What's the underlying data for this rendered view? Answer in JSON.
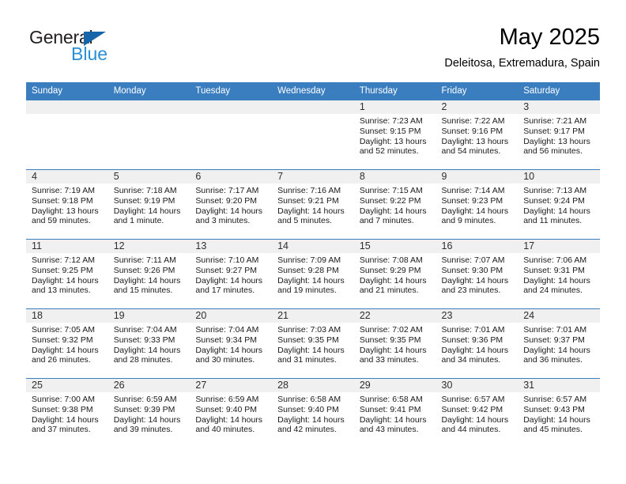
{
  "brand": {
    "name_part1": "General",
    "name_part2": "Blue",
    "triangle_color": "#1565a8",
    "blue_color": "#2a8fd4"
  },
  "header": {
    "month_title": "May 2025",
    "location": "Deleitosa, Extremadura, Spain"
  },
  "theme": {
    "header_bg": "#3a7ec0",
    "daynum_bg": "#f0f0f0",
    "cell_border": "#3a7ec0"
  },
  "weekday_headers": [
    "Sunday",
    "Monday",
    "Tuesday",
    "Wednesday",
    "Thursday",
    "Friday",
    "Saturday"
  ],
  "weeks": [
    [
      {
        "day": "",
        "sunrise": "",
        "sunset": "",
        "daylight1": "",
        "daylight2": "",
        "empty": true
      },
      {
        "day": "",
        "sunrise": "",
        "sunset": "",
        "daylight1": "",
        "daylight2": "",
        "empty": true
      },
      {
        "day": "",
        "sunrise": "",
        "sunset": "",
        "daylight1": "",
        "daylight2": "",
        "empty": true
      },
      {
        "day": "",
        "sunrise": "",
        "sunset": "",
        "daylight1": "",
        "daylight2": "",
        "empty": true
      },
      {
        "day": "1",
        "sunrise": "Sunrise: 7:23 AM",
        "sunset": "Sunset: 9:15 PM",
        "daylight1": "Daylight: 13 hours",
        "daylight2": "and 52 minutes."
      },
      {
        "day": "2",
        "sunrise": "Sunrise: 7:22 AM",
        "sunset": "Sunset: 9:16 PM",
        "daylight1": "Daylight: 13 hours",
        "daylight2": "and 54 minutes."
      },
      {
        "day": "3",
        "sunrise": "Sunrise: 7:21 AM",
        "sunset": "Sunset: 9:17 PM",
        "daylight1": "Daylight: 13 hours",
        "daylight2": "and 56 minutes."
      }
    ],
    [
      {
        "day": "4",
        "sunrise": "Sunrise: 7:19 AM",
        "sunset": "Sunset: 9:18 PM",
        "daylight1": "Daylight: 13 hours",
        "daylight2": "and 59 minutes."
      },
      {
        "day": "5",
        "sunrise": "Sunrise: 7:18 AM",
        "sunset": "Sunset: 9:19 PM",
        "daylight1": "Daylight: 14 hours",
        "daylight2": "and 1 minute."
      },
      {
        "day": "6",
        "sunrise": "Sunrise: 7:17 AM",
        "sunset": "Sunset: 9:20 PM",
        "daylight1": "Daylight: 14 hours",
        "daylight2": "and 3 minutes."
      },
      {
        "day": "7",
        "sunrise": "Sunrise: 7:16 AM",
        "sunset": "Sunset: 9:21 PM",
        "daylight1": "Daylight: 14 hours",
        "daylight2": "and 5 minutes."
      },
      {
        "day": "8",
        "sunrise": "Sunrise: 7:15 AM",
        "sunset": "Sunset: 9:22 PM",
        "daylight1": "Daylight: 14 hours",
        "daylight2": "and 7 minutes."
      },
      {
        "day": "9",
        "sunrise": "Sunrise: 7:14 AM",
        "sunset": "Sunset: 9:23 PM",
        "daylight1": "Daylight: 14 hours",
        "daylight2": "and 9 minutes."
      },
      {
        "day": "10",
        "sunrise": "Sunrise: 7:13 AM",
        "sunset": "Sunset: 9:24 PM",
        "daylight1": "Daylight: 14 hours",
        "daylight2": "and 11 minutes."
      }
    ],
    [
      {
        "day": "11",
        "sunrise": "Sunrise: 7:12 AM",
        "sunset": "Sunset: 9:25 PM",
        "daylight1": "Daylight: 14 hours",
        "daylight2": "and 13 minutes."
      },
      {
        "day": "12",
        "sunrise": "Sunrise: 7:11 AM",
        "sunset": "Sunset: 9:26 PM",
        "daylight1": "Daylight: 14 hours",
        "daylight2": "and 15 minutes."
      },
      {
        "day": "13",
        "sunrise": "Sunrise: 7:10 AM",
        "sunset": "Sunset: 9:27 PM",
        "daylight1": "Daylight: 14 hours",
        "daylight2": "and 17 minutes."
      },
      {
        "day": "14",
        "sunrise": "Sunrise: 7:09 AM",
        "sunset": "Sunset: 9:28 PM",
        "daylight1": "Daylight: 14 hours",
        "daylight2": "and 19 minutes."
      },
      {
        "day": "15",
        "sunrise": "Sunrise: 7:08 AM",
        "sunset": "Sunset: 9:29 PM",
        "daylight1": "Daylight: 14 hours",
        "daylight2": "and 21 minutes."
      },
      {
        "day": "16",
        "sunrise": "Sunrise: 7:07 AM",
        "sunset": "Sunset: 9:30 PM",
        "daylight1": "Daylight: 14 hours",
        "daylight2": "and 23 minutes."
      },
      {
        "day": "17",
        "sunrise": "Sunrise: 7:06 AM",
        "sunset": "Sunset: 9:31 PM",
        "daylight1": "Daylight: 14 hours",
        "daylight2": "and 24 minutes."
      }
    ],
    [
      {
        "day": "18",
        "sunrise": "Sunrise: 7:05 AM",
        "sunset": "Sunset: 9:32 PM",
        "daylight1": "Daylight: 14 hours",
        "daylight2": "and 26 minutes."
      },
      {
        "day": "19",
        "sunrise": "Sunrise: 7:04 AM",
        "sunset": "Sunset: 9:33 PM",
        "daylight1": "Daylight: 14 hours",
        "daylight2": "and 28 minutes."
      },
      {
        "day": "20",
        "sunrise": "Sunrise: 7:04 AM",
        "sunset": "Sunset: 9:34 PM",
        "daylight1": "Daylight: 14 hours",
        "daylight2": "and 30 minutes."
      },
      {
        "day": "21",
        "sunrise": "Sunrise: 7:03 AM",
        "sunset": "Sunset: 9:35 PM",
        "daylight1": "Daylight: 14 hours",
        "daylight2": "and 31 minutes."
      },
      {
        "day": "22",
        "sunrise": "Sunrise: 7:02 AM",
        "sunset": "Sunset: 9:35 PM",
        "daylight1": "Daylight: 14 hours",
        "daylight2": "and 33 minutes."
      },
      {
        "day": "23",
        "sunrise": "Sunrise: 7:01 AM",
        "sunset": "Sunset: 9:36 PM",
        "daylight1": "Daylight: 14 hours",
        "daylight2": "and 34 minutes."
      },
      {
        "day": "24",
        "sunrise": "Sunrise: 7:01 AM",
        "sunset": "Sunset: 9:37 PM",
        "daylight1": "Daylight: 14 hours",
        "daylight2": "and 36 minutes."
      }
    ],
    [
      {
        "day": "25",
        "sunrise": "Sunrise: 7:00 AM",
        "sunset": "Sunset: 9:38 PM",
        "daylight1": "Daylight: 14 hours",
        "daylight2": "and 37 minutes."
      },
      {
        "day": "26",
        "sunrise": "Sunrise: 6:59 AM",
        "sunset": "Sunset: 9:39 PM",
        "daylight1": "Daylight: 14 hours",
        "daylight2": "and 39 minutes."
      },
      {
        "day": "27",
        "sunrise": "Sunrise: 6:59 AM",
        "sunset": "Sunset: 9:40 PM",
        "daylight1": "Daylight: 14 hours",
        "daylight2": "and 40 minutes."
      },
      {
        "day": "28",
        "sunrise": "Sunrise: 6:58 AM",
        "sunset": "Sunset: 9:40 PM",
        "daylight1": "Daylight: 14 hours",
        "daylight2": "and 42 minutes."
      },
      {
        "day": "29",
        "sunrise": "Sunrise: 6:58 AM",
        "sunset": "Sunset: 9:41 PM",
        "daylight1": "Daylight: 14 hours",
        "daylight2": "and 43 minutes."
      },
      {
        "day": "30",
        "sunrise": "Sunrise: 6:57 AM",
        "sunset": "Sunset: 9:42 PM",
        "daylight1": "Daylight: 14 hours",
        "daylight2": "and 44 minutes."
      },
      {
        "day": "31",
        "sunrise": "Sunrise: 6:57 AM",
        "sunset": "Sunset: 9:43 PM",
        "daylight1": "Daylight: 14 hours",
        "daylight2": "and 45 minutes."
      }
    ]
  ]
}
